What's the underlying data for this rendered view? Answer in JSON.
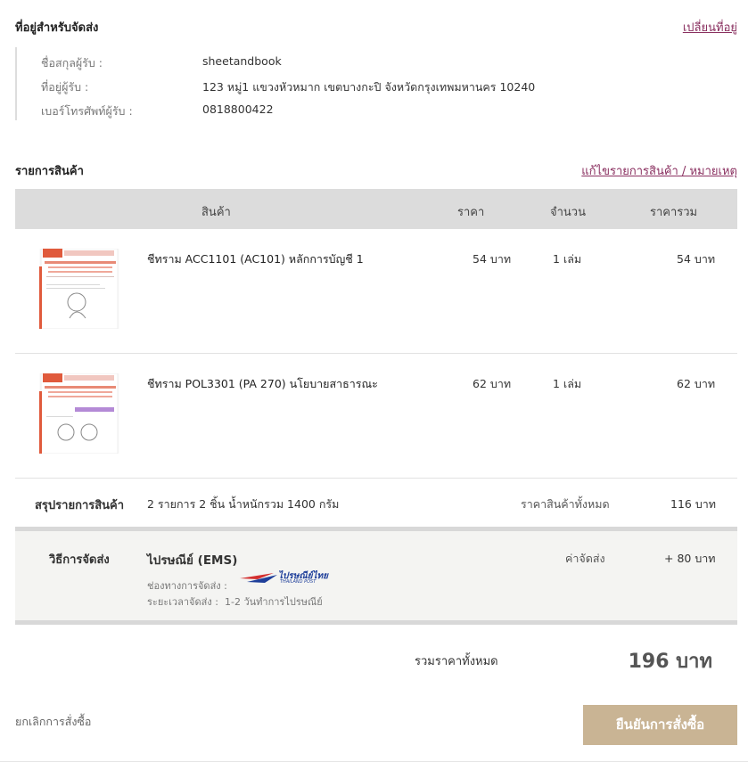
{
  "shipping_address": {
    "title": "ที่อยู่สำหรับจัดส่ง",
    "change_link": "เปลี่ยนที่อยู่",
    "fields": [
      {
        "label": "ชื่อสกุลผู้รับ :",
        "value": "sheetandbook"
      },
      {
        "label": "ที่อยู่ผู้รับ :",
        "value": "123 หมู่1  แขวงหัวหมาก  เขตบางกะปิ  จังหวัดกรุงเทพมหานคร  10240"
      },
      {
        "label": "เบอร์โทรศัพท์ผู้รับ :",
        "value": "0818800422"
      }
    ]
  },
  "products": {
    "title": "รายการสินค้า",
    "edit_link": "แก้ไขรายการสินค้า / หมายเหตุ",
    "columns": {
      "product": "สินค้า",
      "price": "ราคา",
      "quantity": "จำนวน",
      "total": "ราคารวม"
    },
    "items": [
      {
        "name": "ชีทราม ACC1101 (AC101) หลักการบัญชี 1",
        "price": "54 บาท",
        "quantity": "1 เล่ม",
        "total": "54 บาท"
      },
      {
        "name": "ชีทราม POL3301 (PA 270) นโยบายสาธารณะ",
        "price": "62 บาท",
        "quantity": "1 เล่ม",
        "total": "62 บาท"
      }
    ]
  },
  "summary": {
    "label": "สรุปรายการสินค้า",
    "detail": "2 รายการ 2 ชิ้น น้ำหนักรวม 1400 กรัม",
    "subtotal_label": "ราคาสินค้าทั้งหมด",
    "subtotal_value": "116 บาท"
  },
  "shipping": {
    "label": "วิธีการจัดส่ง",
    "method": "ไปรษณีย์ (EMS)",
    "logo_text": "ไปรษณีย์ไทย",
    "logo_subtext": "THAILAND POST",
    "channel_label": "ช่องทางการจัดส่ง :",
    "duration_label": "ระยะเวลาจัดส่ง :",
    "duration_value": "1-2 วันทำการไปรษณีย์",
    "fee_label": "ค่าจัดส่ง",
    "fee_value": "+ 80 บาท"
  },
  "total": {
    "label": "รวมราคาทั้งหมด",
    "value": "196 บาท"
  },
  "actions": {
    "cancel": "ยกเลิกการสั่งซื้อ",
    "confirm": "ยืนยันการสั่งซื้อ"
  },
  "colors": {
    "link": "#8a3060",
    "confirm_button": "#c9b494",
    "table_header": "#dcdcdc",
    "shipping_bg": "#f4f4f2"
  }
}
